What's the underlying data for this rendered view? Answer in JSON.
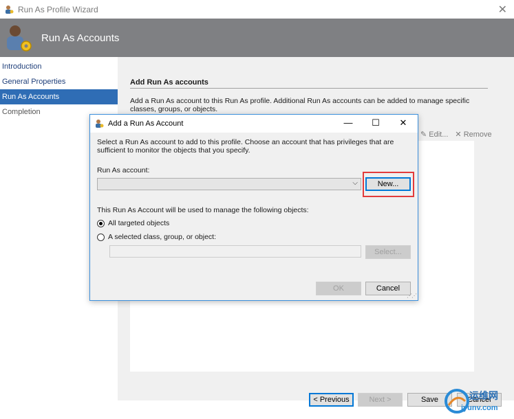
{
  "window": {
    "title": "Run As Profile Wizard",
    "close_glyph": "✕",
    "header_title": "Run As Accounts"
  },
  "nav": {
    "items": [
      {
        "label": "Introduction"
      },
      {
        "label": "General Properties"
      },
      {
        "label": "Run As Accounts"
      },
      {
        "label": "Completion"
      }
    ]
  },
  "content": {
    "section_title": "Add Run As accounts",
    "description": "Add a Run As account to this Run As profile.  Additional Run As accounts can be added to manage specific classes, groups, or objects.",
    "edit_label": "Edit...",
    "remove_label": "Remove"
  },
  "dialog": {
    "title": "Add a Run As Account",
    "description": "Select a Run As account to add to this profile.  Choose an account that has privileges that are sufficient to monitor the objects that you specify.",
    "account_label": "Run As account:",
    "account_value": "",
    "new_button": "New...",
    "manage_text": "This Run As Account will be used to manage the following objects:",
    "radio_all": "All targeted objects",
    "radio_selected": "A selected class, group, or object:",
    "object_value": "",
    "select_button": "Select...",
    "ok_button": "OK",
    "cancel_button": "Cancel"
  },
  "footer": {
    "previous_button": "< Previous",
    "next_button": "Next >",
    "save_button": "Save",
    "cancel_button": "Cancel"
  },
  "watermark": {
    "line1": "运维网",
    "line2": "iyunv.com"
  },
  "colors": {
    "header_bg": "#7f8083",
    "nav_selected": "#2f6db5",
    "dialog_border": "#3b8fdc",
    "highlight": "#e23b3b"
  }
}
